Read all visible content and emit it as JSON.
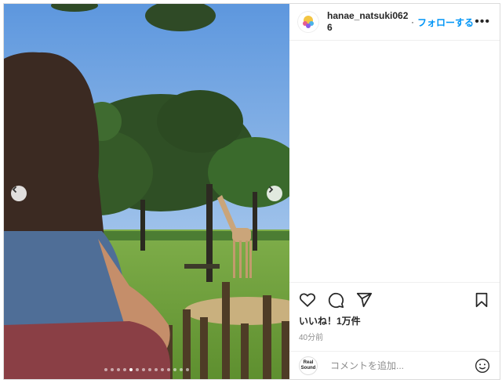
{
  "post": {
    "username": "hanae_natsuki0626",
    "separator": "·",
    "follow_label": "フォローする",
    "more_icon": "more-horizontal-icon",
    "likes": "いいね！1万件",
    "time_ago": "40分前",
    "comment_placeholder": "コメントを追加...",
    "commenter_avatar_text": "Real Sound",
    "carousel": {
      "total_slides": 14,
      "active_index": 4
    }
  },
  "icons": [
    "heart-icon",
    "comment-icon",
    "share-icon",
    "bookmark-icon",
    "emoji-icon",
    "chevron-left-icon",
    "chevron-right-icon"
  ],
  "colors": {
    "follow_blue": "#0095f6",
    "text": "#262626",
    "muted": "#8e8e8e",
    "border": "#dbdbdb"
  }
}
